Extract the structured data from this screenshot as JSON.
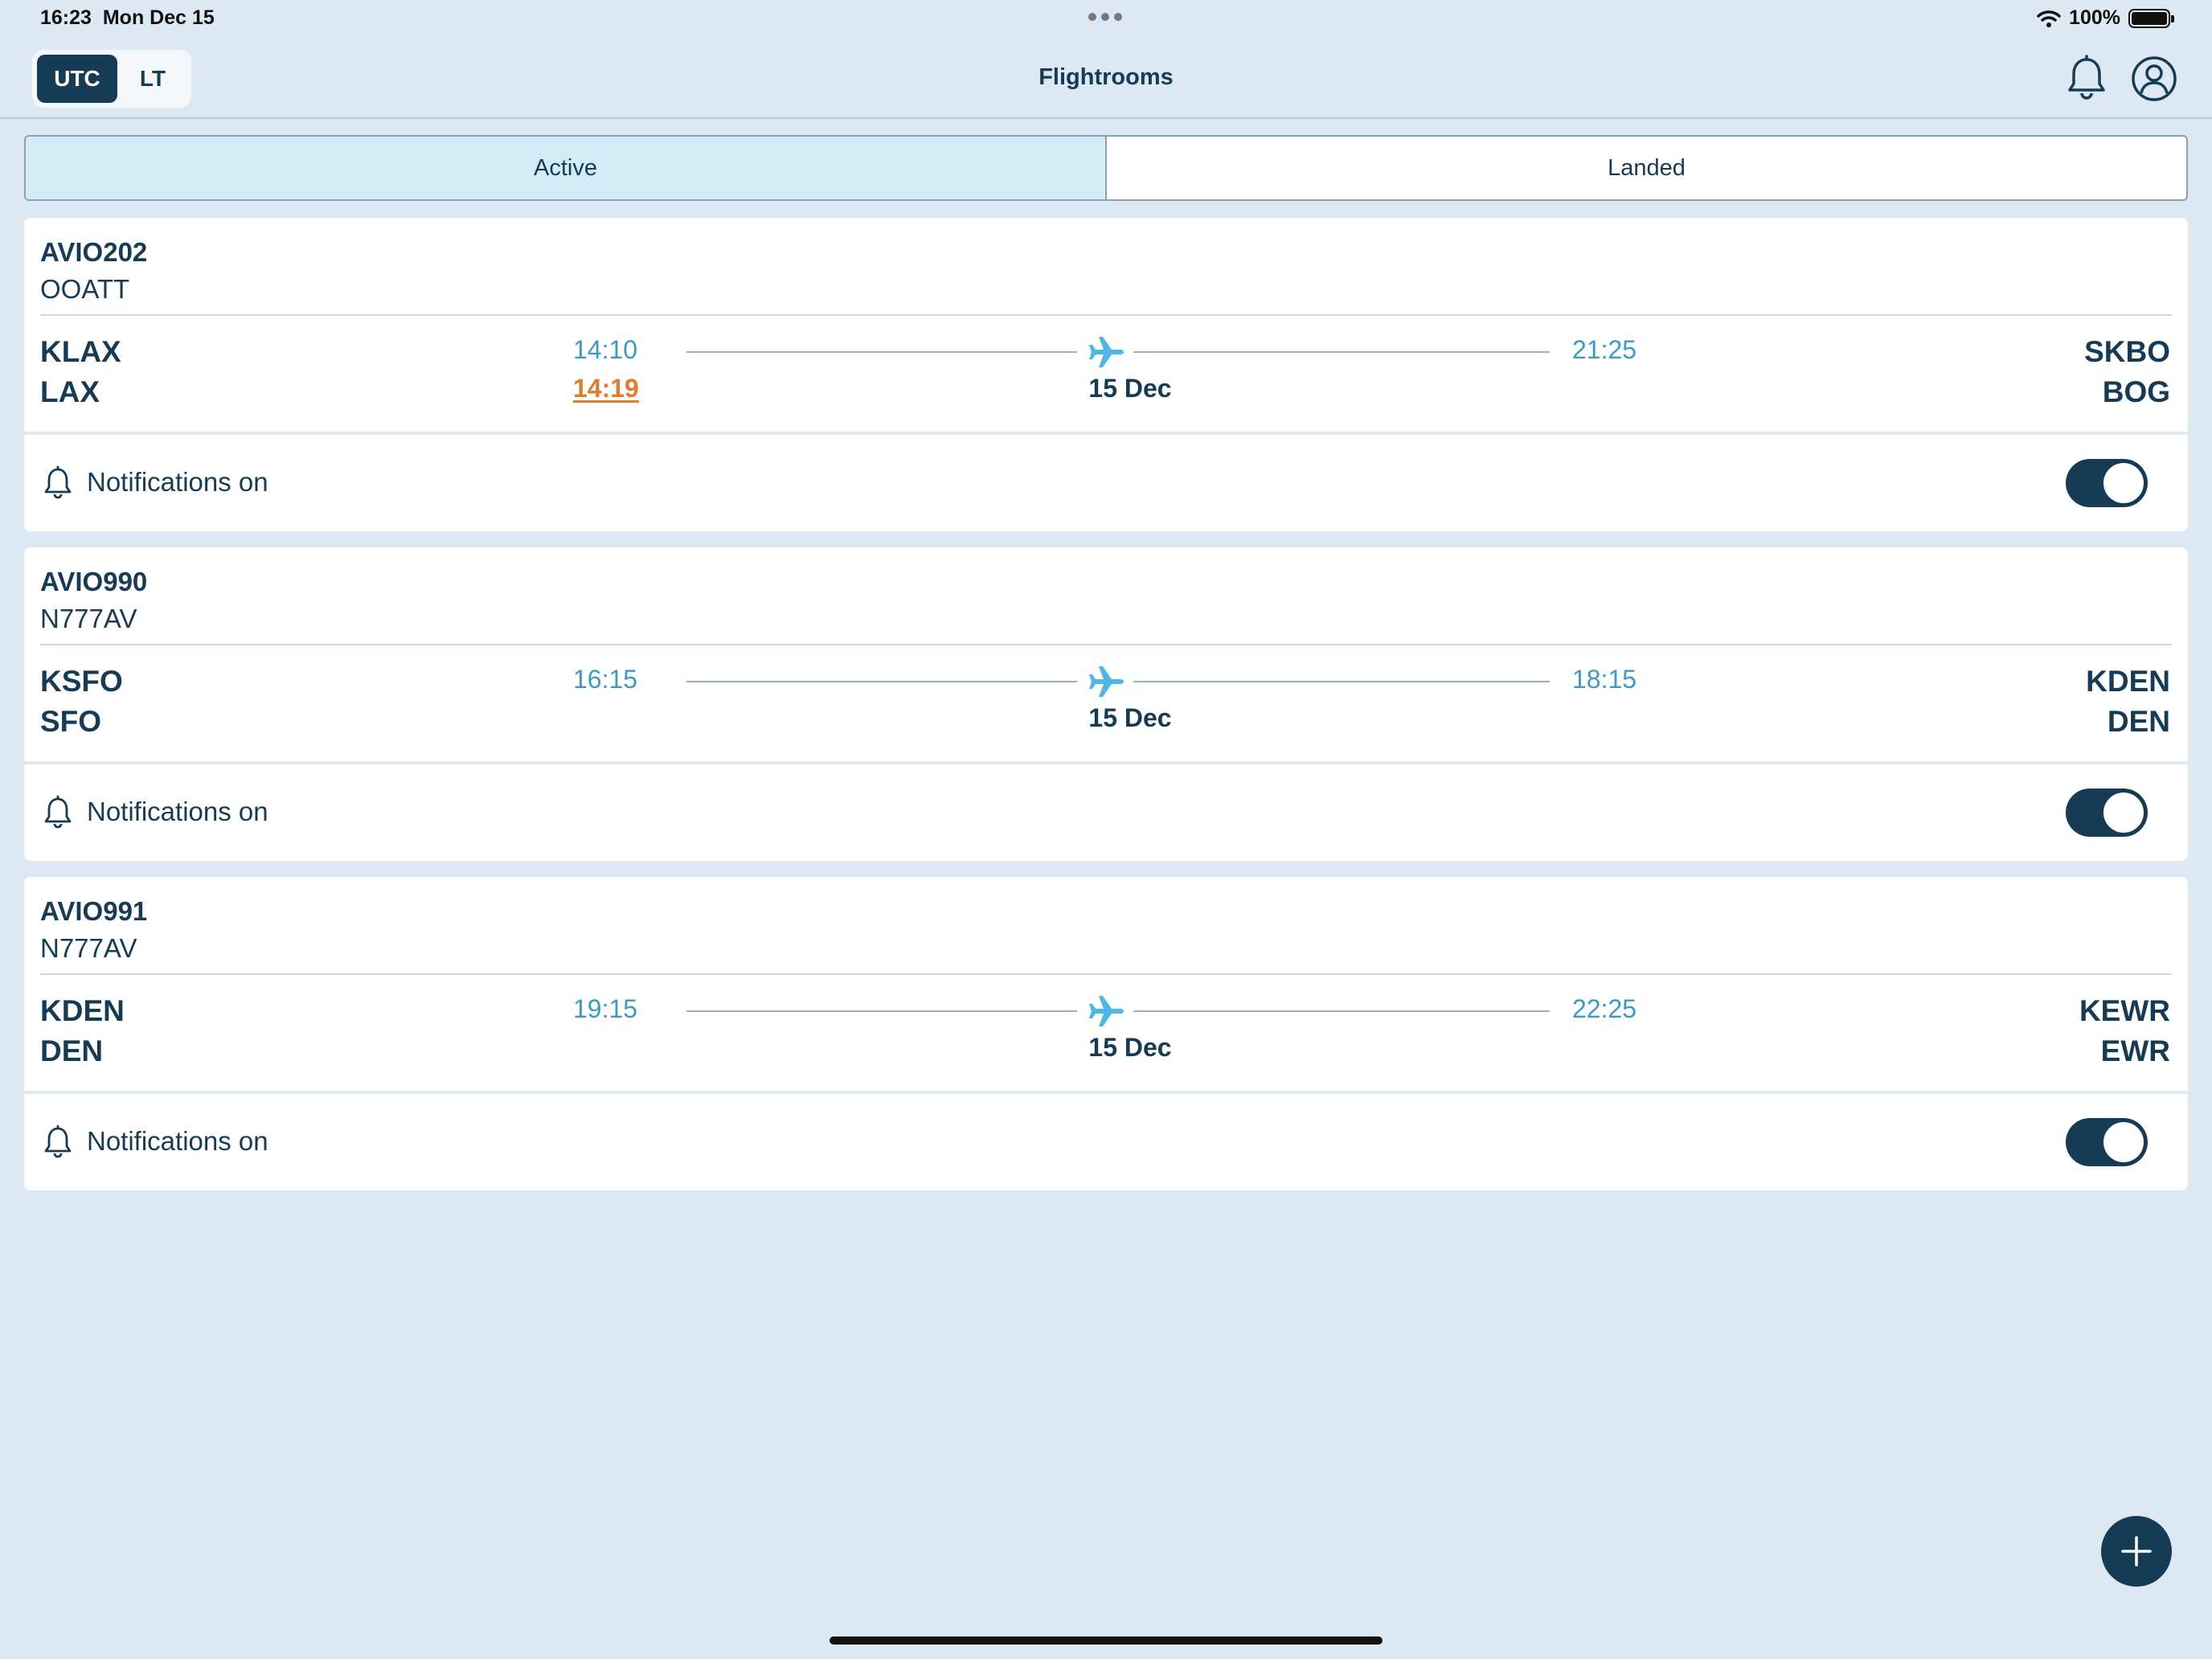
{
  "status_bar": {
    "time": "16:23",
    "date": "Mon Dec 15",
    "battery": "100%"
  },
  "header": {
    "tz_utc": "UTC",
    "tz_lt": "LT",
    "tz_selected": "UTC",
    "title": "Flightrooms",
    "icons": [
      "bell-icon",
      "user-icon"
    ]
  },
  "tabs": [
    {
      "label": "Active",
      "active": true
    },
    {
      "label": "Landed",
      "active": false
    }
  ],
  "flights": [
    {
      "flight_no": "AVIO202",
      "registration": "OOATT",
      "origin_icao": "KLAX",
      "origin_iata": "LAX",
      "dep_time": "14:10",
      "dep_actual": "14:19",
      "arr_time": "21:25",
      "date": "15 Dec",
      "dest_icao": "SKBO",
      "dest_iata": "BOG",
      "notifications_label": "Notifications on",
      "notifications_enabled": true
    },
    {
      "flight_no": "AVIO990",
      "registration": "N777AV",
      "origin_icao": "KSFO",
      "origin_iata": "SFO",
      "dep_time": "16:15",
      "arr_time": "18:15",
      "date": "15 Dec",
      "dest_icao": "KDEN",
      "dest_iata": "DEN",
      "notifications_label": "Notifications on",
      "notifications_enabled": true
    },
    {
      "flight_no": "AVIO991",
      "registration": "N777AV",
      "origin_icao": "KDEN",
      "origin_iata": "DEN",
      "dep_time": "19:15",
      "arr_time": "22:25",
      "date": "15 Dec",
      "dest_icao": "KEWR",
      "dest_iata": "EWR",
      "notifications_label": "Notifications on",
      "notifications_enabled": true
    }
  ],
  "colors": {
    "primary": "#163b55",
    "accent": "#3a9bc6",
    "delay": "#e07c2b",
    "background": "#dde9f2"
  }
}
